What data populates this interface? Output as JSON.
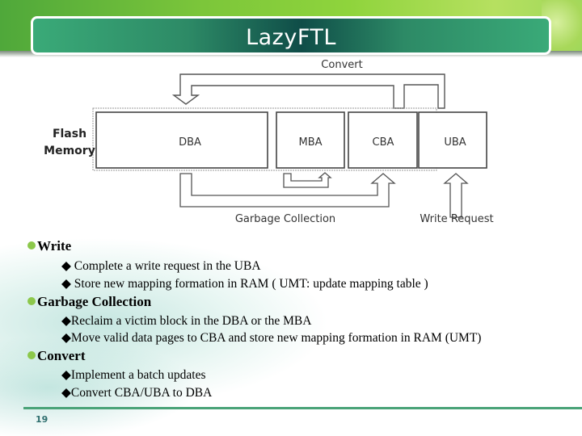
{
  "slide": {
    "title": "LazyFTL",
    "page_number": "19"
  },
  "diagram": {
    "side_label_line1": "Flash",
    "side_label_line2": "Memory",
    "blocks": [
      "DBA",
      "MBA",
      "CBA",
      "UBA"
    ],
    "top_label": "Convert",
    "bottom_label_gc": "Garbage Collection",
    "bottom_label_write": "Write Request"
  },
  "bullets": [
    {
      "heading": "Write",
      "items": [
        "◆ Complete a write request in the UBA",
        "◆ Store new  mapping  formation in RAM  ( UMT: update mapping table )"
      ]
    },
    {
      "heading": "Garbage Collection",
      "items": [
        "◆Reclaim a victim block  in  the DBA  or the MBA",
        "◆Move valid data pages to CBA and store new  mapping  formation in RAM (UMT)"
      ]
    },
    {
      "heading": "Convert",
      "items": [
        "◆Implement a batch updates",
        "◆Convert CBA/UBA to DBA"
      ]
    }
  ],
  "colors": {
    "title_bar_dark": "#0f4d48",
    "title_bar_light": "#3aaa78",
    "bullet_dot": "#8cc84b",
    "footer_line": "#4aa378"
  }
}
